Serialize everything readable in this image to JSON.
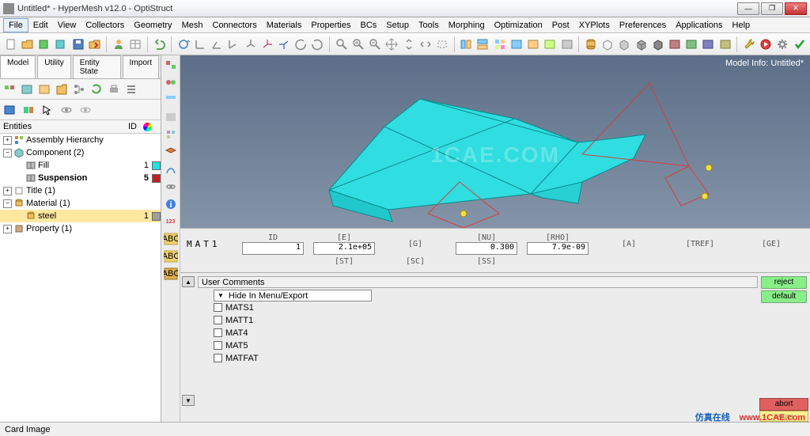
{
  "window": {
    "title": "Untitled* - HyperMesh v12.0 - OptiStruct"
  },
  "menu": [
    "File",
    "Edit",
    "View",
    "Collectors",
    "Geometry",
    "Mesh",
    "Connectors",
    "Materials",
    "Properties",
    "BCs",
    "Setup",
    "Tools",
    "Morphing",
    "Optimization",
    "Post",
    "XYPlots",
    "Preferences",
    "Applications",
    "Help"
  ],
  "tabs": {
    "model": "Model",
    "utility": "Utility",
    "entity": "Entity State",
    "import": "Import"
  },
  "treeheader": {
    "entities": "Entities",
    "id": "ID"
  },
  "tree": {
    "assembly": {
      "label": "Assembly Hierarchy"
    },
    "component": {
      "label": "Component (2)"
    },
    "fill": {
      "label": "Fill",
      "id": "1",
      "color": "#20e0e0"
    },
    "suspension": {
      "label": "Suspension",
      "id": "5",
      "color": "#c02020"
    },
    "title": {
      "label": "Title (1)"
    },
    "material": {
      "label": "Material (1)"
    },
    "steel": {
      "label": "steel",
      "id": "1",
      "color": "#a0a0a0"
    },
    "property": {
      "label": "Property (1)"
    }
  },
  "viewport": {
    "modelinfo": "Model Info: Untitled*",
    "watermark": "1CAE.COM"
  },
  "params": {
    "name": "MAT1",
    "row1": [
      {
        "label": "ID",
        "value": "1"
      },
      {
        "label": "[E]",
        "value": "2.1e+05"
      },
      {
        "label": "[G]",
        "value": ""
      },
      {
        "label": "[NU]",
        "value": "0.300"
      },
      {
        "label": "[RHO]",
        "value": "7.9e-09"
      },
      {
        "label": "[A]",
        "value": ""
      },
      {
        "label": "[TREF]",
        "value": ""
      },
      {
        "label": "[GE]",
        "value": ""
      }
    ],
    "row2": [
      "[ST]",
      "[SC]",
      "[SS]"
    ]
  },
  "comments": {
    "header": "User Comments",
    "dropdown": "Hide In Menu/Export",
    "items": [
      "MATS1",
      "MATT1",
      "MAT4",
      "MAT5",
      "MATFAT"
    ]
  },
  "actions": {
    "reject": "reject",
    "default": "default",
    "abort": "abort",
    "return": "return"
  },
  "status": "Card Image",
  "brand": {
    "cn": "仿真在线",
    "url": "www.1CAE.com"
  }
}
